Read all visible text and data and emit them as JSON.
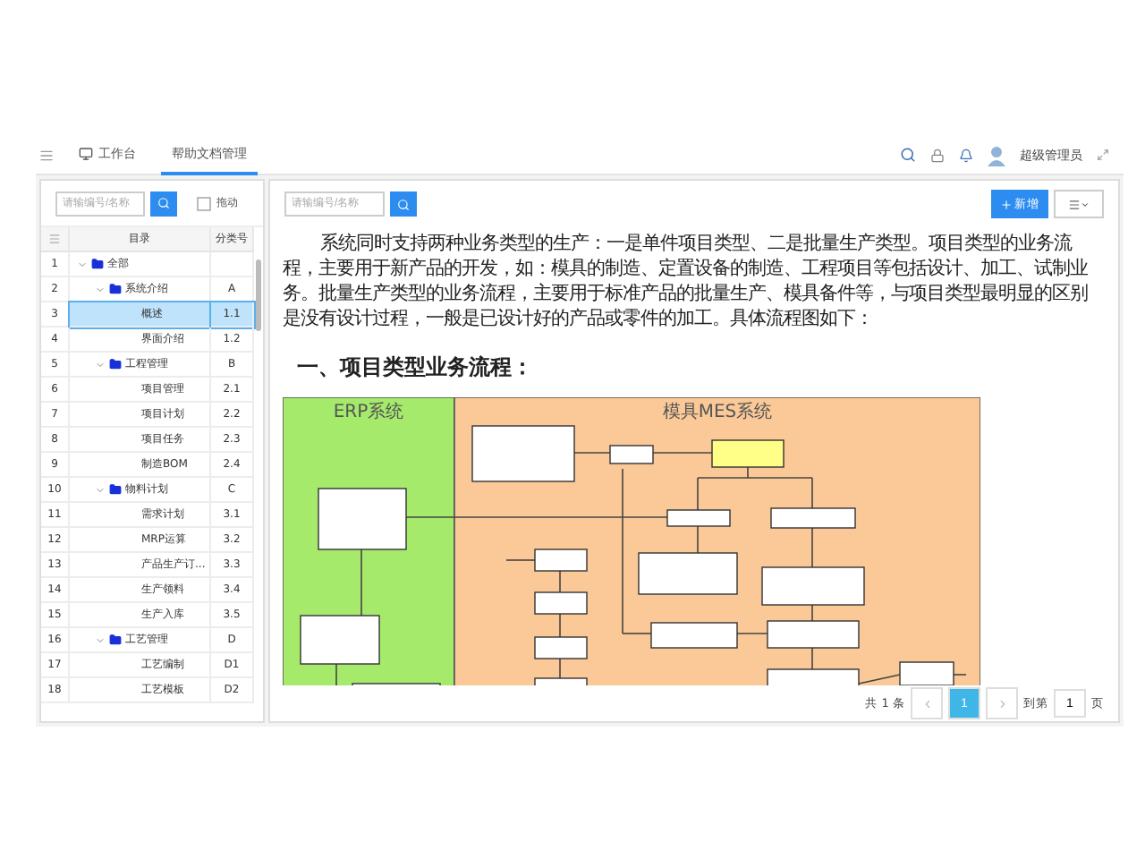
{
  "topbar": {
    "tabs": [
      {
        "label": "工作台",
        "kind": "workbench",
        "selected": false
      },
      {
        "label": "帮助文档管理",
        "kind": "page",
        "selected": true
      }
    ],
    "user": {
      "name": "超级管理员"
    }
  },
  "left_panel": {
    "search": {
      "placeholder": "请输编号/名称"
    },
    "drag_toggle": {
      "label": "拖动",
      "checked": false
    },
    "table": {
      "columns": [
        "目录",
        "分类号"
      ],
      "rows": [
        {
          "no": "1",
          "name": "全部",
          "code": "",
          "folder": true,
          "expanded": true,
          "selected": false,
          "children": [
            {
              "no": "2",
              "name": "系统介绍",
              "code": "A",
              "folder": true,
              "expanded": true,
              "selected": false,
              "children": [
                {
                  "no": "3",
                  "name": "概述",
                  "code": "1.1",
                  "folder": false,
                  "selected": true
                },
                {
                  "no": "4",
                  "name": "界面介绍",
                  "code": "1.2",
                  "folder": false,
                  "selected": false
                }
              ]
            },
            {
              "no": "5",
              "name": "工程管理",
              "code": "B",
              "folder": true,
              "expanded": true,
              "selected": false,
              "children": [
                {
                  "no": "6",
                  "name": "项目管理",
                  "code": "2.1",
                  "folder": false,
                  "selected": false
                },
                {
                  "no": "7",
                  "name": "项目计划",
                  "code": "2.2",
                  "folder": false,
                  "selected": false
                },
                {
                  "no": "8",
                  "name": "项目任务",
                  "code": "2.3",
                  "folder": false,
                  "selected": false
                },
                {
                  "no": "9",
                  "name": "制造BOM",
                  "code": "2.4",
                  "folder": false,
                  "selected": false
                }
              ]
            },
            {
              "no": "10",
              "name": "物料计划",
              "code": "C",
              "folder": true,
              "expanded": true,
              "selected": false,
              "children": [
                {
                  "no": "11",
                  "name": "需求计划",
                  "code": "3.1",
                  "folder": false,
                  "selected": false
                },
                {
                  "no": "12",
                  "name": "MRP运算",
                  "code": "3.2",
                  "folder": false,
                  "selected": false
                },
                {
                  "no": "13",
                  "name": "产品生产订...",
                  "code": "3.3",
                  "folder": false,
                  "selected": false
                },
                {
                  "no": "14",
                  "name": "生产领料",
                  "code": "3.4",
                  "folder": false,
                  "selected": false
                },
                {
                  "no": "15",
                  "name": "生产入库",
                  "code": "3.5",
                  "folder": false,
                  "selected": false
                }
              ]
            },
            {
              "no": "16",
              "name": "工艺管理",
              "code": "D",
              "folder": true,
              "expanded": true,
              "selected": false,
              "children": [
                {
                  "no": "17",
                  "name": "工艺编制",
                  "code": "D1",
                  "folder": false,
                  "selected": false
                },
                {
                  "no": "18",
                  "name": "工艺模板",
                  "code": "D2",
                  "folder": false,
                  "selected": false
                }
              ]
            }
          ]
        }
      ]
    }
  },
  "right_panel": {
    "search": {
      "placeholder": "请输编号/名称"
    },
    "add_button": "新增",
    "document": {
      "paragraph": "系统同时支持两种业务类型的生产：一是单件项目类型、二是批量生产类型。项目类型的业务流程，主要用于新产品的开发，如：模具的制造、定置设备的制造、工程项目等包括设计、加工、试制业务。批量生产类型的业务流程，主要用于标准产品的批量生产、模具备件等，与项目类型最明显的区别是没有设计过程，一般是已设计好的产品或零件的加工。具体流程图如下：",
      "heading": "一、项目类型业务流程：",
      "flowchart": {
        "columns": [
          "ERP系统",
          "模具MES系统"
        ]
      }
    },
    "pagination": {
      "total": "共 1 条",
      "pages": [
        {
          "label": "1",
          "selected": true
        }
      ],
      "goto_label": "到第",
      "goto_value": "1",
      "goto_suffix": "页"
    }
  }
}
